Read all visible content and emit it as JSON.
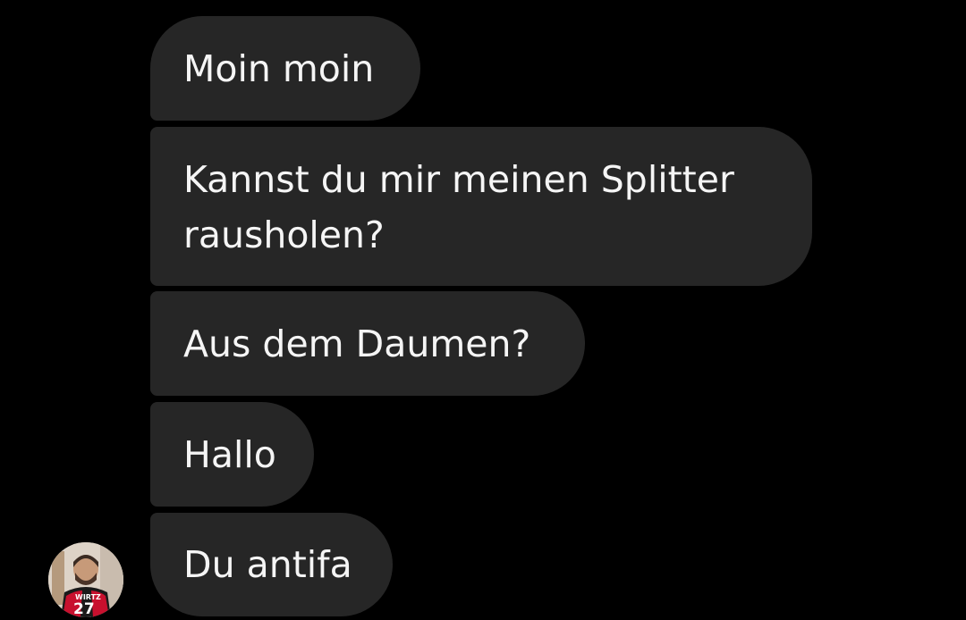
{
  "conversation": {
    "messages": [
      {
        "text": "Moin moin"
      },
      {
        "text": "Kannst du mir meinen Splitter rausholen?"
      },
      {
        "text": "Aus dem Daumen?"
      },
      {
        "text": "Hallo"
      },
      {
        "text": "Du antifa"
      }
    ],
    "sender_avatar": {
      "icon": "user-avatar-photo",
      "jersey_name": "WIRTZ",
      "jersey_number": "27"
    }
  },
  "colors": {
    "background": "#000000",
    "bubble": "#262626",
    "text": "#f5f5f5"
  }
}
